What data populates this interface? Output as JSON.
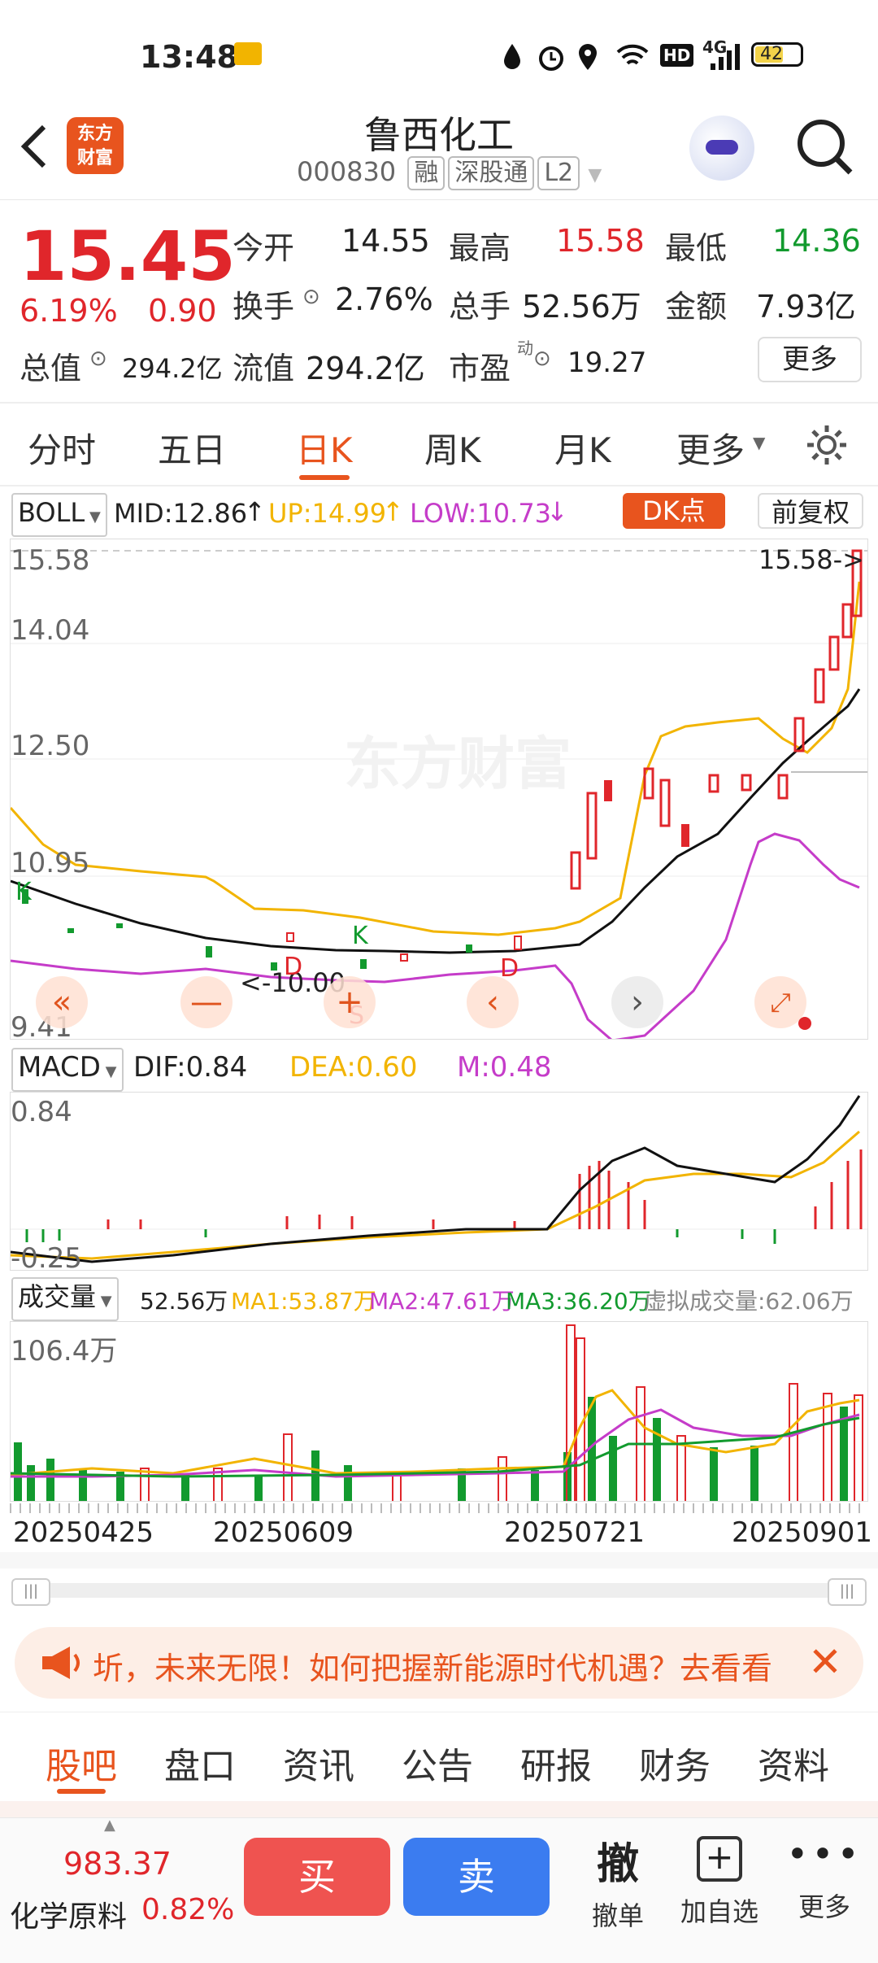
{
  "status_bar": {
    "time": "13:48",
    "battery": "42",
    "network": "4G",
    "hd": "HD"
  },
  "header": {
    "logo_text": "东方财富",
    "title": "鲁西化工",
    "code": "000830",
    "tags": [
      "融",
      "深股通",
      "L2"
    ]
  },
  "quote": {
    "price": "15.45",
    "change_pct": "6.19%",
    "change_abs": "0.90",
    "stats": [
      {
        "label": "今开",
        "value": "14.55",
        "color": "#222"
      },
      {
        "label": "最高",
        "value": "15.58",
        "color": "#e0262b"
      },
      {
        "label": "最低",
        "value": "14.36",
        "color": "#129a2e"
      },
      {
        "label": "换手",
        "value": "2.76%",
        "color": "#222"
      },
      {
        "label": "总手",
        "value": "52.56万",
        "color": "#222"
      },
      {
        "label": "金额",
        "value": "7.93亿",
        "color": "#222"
      },
      {
        "label": "总值",
        "value": "294.2亿",
        "color": "#222"
      },
      {
        "label": "流值",
        "value": "294.2亿",
        "color": "#222"
      },
      {
        "label": "市盈",
        "value": "19.27",
        "color": "#222"
      }
    ],
    "pe_superscript": "动",
    "more_button": "更多"
  },
  "period_tabs": [
    "分时",
    "五日",
    "日K",
    "周K",
    "月K",
    "更多"
  ],
  "active_tab": "日K",
  "boll": {
    "selector": "BOLL",
    "mid": "MID:12.86",
    "up": "UP:14.99",
    "low": "LOW:10.73",
    "dk_button": "DK点",
    "fq_button": "前复权",
    "axis": [
      "15.58",
      "14.04",
      "12.50",
      "10.95",
      "9.41"
    ],
    "high_marker": "15.58->",
    "low_marker": "<-10.00",
    "watermark": "东方财富"
  },
  "macd": {
    "selector": "MACD",
    "dif": "DIF:0.84",
    "dea": "DEA:0.60",
    "m": "M:0.48",
    "axis_top": "0.84",
    "axis_bottom": "-0.25"
  },
  "volume": {
    "selector": "成交量",
    "vol": "52.56万",
    "ma1": "MA1:53.87万",
    "ma2": "MA2:47.61万",
    "ma3": "MA3:36.20万",
    "virtual": "虚拟成交量:62.06万",
    "axis_top": "106.4万",
    "dates": [
      "20250425",
      "20250609",
      "20250721",
      "20250901"
    ]
  },
  "banner": {
    "text": "圻，未来无限！如何把握新能源时代机遇？去看看"
  },
  "bottom_tabs": [
    "股吧",
    "盘口",
    "资讯",
    "公告",
    "研报",
    "财务",
    "资料"
  ],
  "active_bottom_tab": "股吧",
  "footer": {
    "index_value": "983.37",
    "index_name": "化学原料",
    "index_change": "0.82%",
    "buy": "买",
    "sell": "卖",
    "cancel_big": "撤",
    "cancel_label": "撤单",
    "add_label": "加自选",
    "more_label": "更多"
  },
  "colors": {
    "up": "#e0262b",
    "down": "#129a2e",
    "accent": "#e8541e",
    "sell_blue": "#3b7cf0",
    "buy_red": "#ef5350"
  }
}
